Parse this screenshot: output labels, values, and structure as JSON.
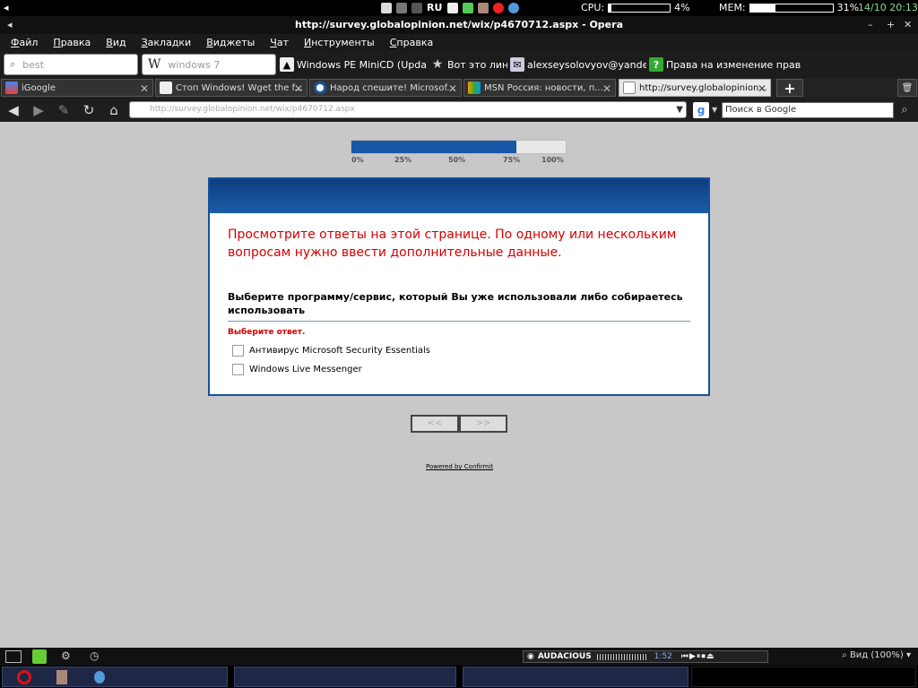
{
  "system": {
    "lang": "RU",
    "cpu_label": "CPU:",
    "cpu_pct": 4,
    "cpu_text": "4%",
    "mem_label": "MEM:",
    "mem_pct": 31,
    "mem_text": "31%",
    "clock": "14/10 20:13"
  },
  "window": {
    "title": "http://survey.globalopinion.net/wix/p4670712.aspx - Opera"
  },
  "menu": [
    "Файл",
    "Правка",
    "Вид",
    "Закладки",
    "Виджеты",
    "Чат",
    "Инструменты",
    "Справка"
  ],
  "bookmarks": {
    "search1_placeholder": "best",
    "search2_placeholder": "windows 7",
    "items": [
      "Windows PE MiniCD (Updat...",
      "Вот это линк!",
      "alexseysolovyov@yandex.ru",
      "Права на изменение прав ..."
    ]
  },
  "tabs": [
    {
      "title": "iGoogle"
    },
    {
      "title": "Стоп Windows! Wget the f..."
    },
    {
      "title": "Народ спешите! Microsof..."
    },
    {
      "title": "MSN Россия: новости, п..."
    },
    {
      "title": "http://survey.globalopinion..."
    }
  ],
  "address": {
    "url": "http://survey.globalopinion.net/wix/p4670712.aspx",
    "search_placeholder": "Поиск в Google"
  },
  "survey": {
    "progress_pct": 77,
    "progress_labels": [
      "0%",
      "25%",
      "50%",
      "75%",
      "100%"
    ],
    "error_message": "Просмотрите ответы на этой странице. По одному или нескольким вопросам нужно ввести дополнительные данные.",
    "question": "Выберите программу/сервис, который Вы уже использовали либо собираетесь использовать",
    "required_message": "Выберите ответ.",
    "options": [
      "Антивирус Microsoft Security Essentials",
      "Windows Live Messenger"
    ],
    "prev_label": "<<",
    "next_label": ">>",
    "powered_by": "Powered by Confirmit"
  },
  "status": {
    "player": "AUDACIOUS",
    "player_time": "1:52",
    "zoom": "Вид (100%)"
  },
  "colors": {
    "accent": "#1757a5",
    "error": "#d40000"
  }
}
